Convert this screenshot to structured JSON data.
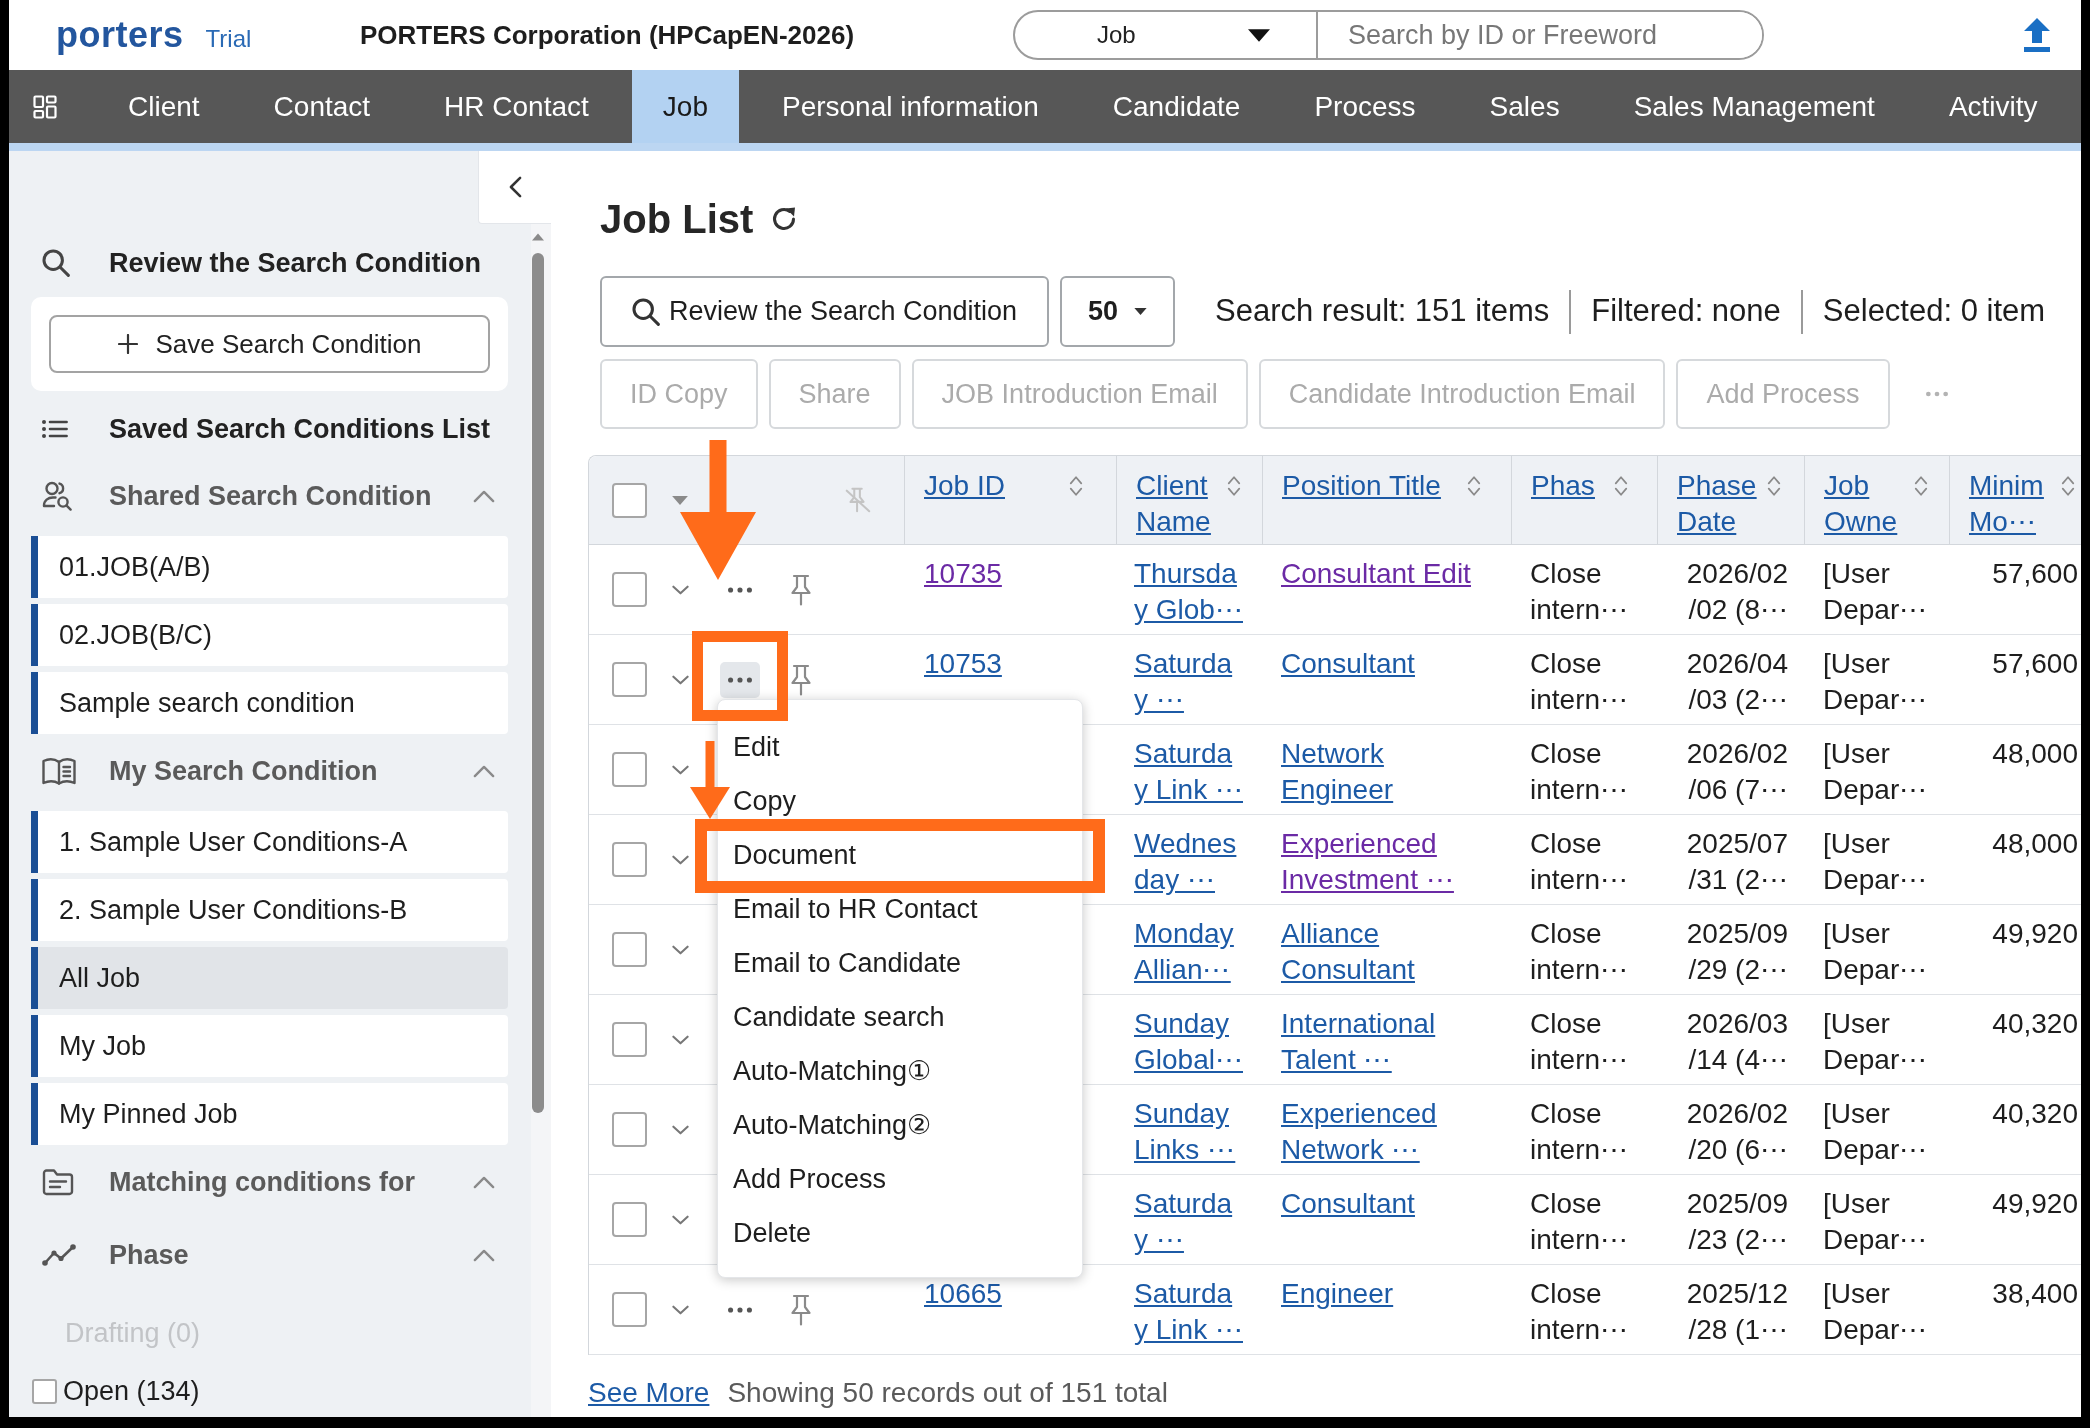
{
  "header": {
    "logo": "porters",
    "edition": "Trial",
    "company": "PORTERS Corporation (HPCapEN-2026)",
    "search": {
      "scope": "Job",
      "placeholder": "Search by ID or Freeword"
    }
  },
  "nav": {
    "items": [
      {
        "label": "Client",
        "selected": false
      },
      {
        "label": "Contact",
        "selected": false
      },
      {
        "label": "HR Contact",
        "selected": false
      },
      {
        "label": "Job",
        "selected": true
      },
      {
        "label": "Personal information",
        "selected": false
      },
      {
        "label": "Candidate",
        "selected": false
      },
      {
        "label": "Process",
        "selected": false
      },
      {
        "label": "Sales",
        "selected": false
      },
      {
        "label": "Sales Management",
        "selected": false
      },
      {
        "label": "Activity",
        "selected": false
      }
    ]
  },
  "sidebar": {
    "review_link": "Review the Search Condition",
    "save_button": "Save Search Condition",
    "saved_list_link": "Saved Search Conditions List",
    "sections": [
      {
        "title": "Shared Search Condition",
        "expanded": true,
        "items": [
          {
            "label": "01.JOB(A/B)",
            "selected": false
          },
          {
            "label": "02.JOB(B/C)",
            "selected": false
          },
          {
            "label": "Sample search condition",
            "selected": false
          }
        ]
      },
      {
        "title": "My Search Condition",
        "expanded": true,
        "items": [
          {
            "label": "1. Sample User Conditions-A",
            "selected": false
          },
          {
            "label": "2. Sample User Conditions-B",
            "selected": false
          },
          {
            "label": "All Job",
            "selected": true
          },
          {
            "label": "My Job",
            "selected": false
          },
          {
            "label": "My Pinned Job",
            "selected": false
          }
        ]
      },
      {
        "title": "Matching conditions for",
        "expanded": true
      },
      {
        "title": "Phase",
        "expanded": true,
        "filters": [
          {
            "label": "Drafting (0)",
            "disabled": true
          },
          {
            "label": "Open (134)",
            "disabled": false,
            "checked": false
          }
        ]
      }
    ]
  },
  "main": {
    "title": "Job List",
    "toolbar": {
      "review_button": "Review the Search Condition",
      "page_size": "50",
      "result": "Search result: 151 items",
      "filtered": "Filtered: none",
      "selected": "Selected: 0 item"
    },
    "actions": [
      {
        "label": "ID Copy",
        "disabled": true
      },
      {
        "label": "Share",
        "disabled": true
      },
      {
        "label": "JOB Introduction Email",
        "disabled": true
      },
      {
        "label": "Candidate Introduction Email",
        "disabled": true
      },
      {
        "label": "Add Process",
        "disabled": true
      }
    ],
    "table": {
      "select_all": {
        "checked": false
      },
      "columns": [
        {
          "lines": [
            "Job ID"
          ]
        },
        {
          "lines": [
            "Client",
            "Name"
          ]
        },
        {
          "lines": [
            "Position Title"
          ]
        },
        {
          "lines": [
            "Phas"
          ]
        },
        {
          "lines": [
            "Phase",
            "Date"
          ]
        },
        {
          "lines": [
            "Job",
            "Owne"
          ]
        },
        {
          "lines": [
            "Minim",
            "Mo⋯"
          ]
        }
      ],
      "rows": [
        {
          "checked": false,
          "more": {
            "active": false,
            "callout": false
          },
          "job_id": {
            "text": "10735",
            "visited": true
          },
          "client_name": [
            "Thursda",
            "y Glob⋯"
          ],
          "position_title": {
            "lines": [
              "Consultant Edit"
            ],
            "visited": true
          },
          "phase": [
            "Close",
            "intern⋯"
          ],
          "phase_date": [
            "2026/02",
            "/02 (8⋯"
          ],
          "job_owner": [
            "[User",
            "Depar⋯"
          ],
          "minimum": "57,600"
        },
        {
          "checked": false,
          "more": {
            "active": true,
            "callout": true
          },
          "job_id": {
            "text": "10753",
            "visited": false
          },
          "client_name": [
            "Saturda",
            "y ⋯"
          ],
          "position_title": {
            "lines": [
              "Consultant"
            ],
            "visited": false
          },
          "phase": [
            "Close",
            "intern⋯"
          ],
          "phase_date": [
            "2026/04",
            "/03 (2⋯"
          ],
          "job_owner": [
            "[User",
            "Depar⋯"
          ],
          "minimum": "57,600"
        },
        {
          "checked": false,
          "client_name": [
            "Saturda",
            "y Link ⋯"
          ],
          "position_title": {
            "lines": [
              "Network",
              "Engineer"
            ],
            "visited": false
          },
          "phase": [
            "Close",
            "intern⋯"
          ],
          "phase_date": [
            "2026/02",
            "/06 (7⋯"
          ],
          "job_owner": [
            "[User",
            "Depar⋯"
          ],
          "minimum": "48,000"
        },
        {
          "checked": false,
          "client_name": [
            "Wednes",
            "day ⋯"
          ],
          "position_title": {
            "lines": [
              "Experienced",
              "Investment ⋯"
            ],
            "visited": true
          },
          "phase": [
            "Close",
            "intern⋯"
          ],
          "phase_date": [
            "2025/07",
            "/31 (2⋯"
          ],
          "job_owner": [
            "[User",
            "Depar⋯"
          ],
          "minimum": "48,000"
        },
        {
          "checked": false,
          "client_name": [
            "Monday",
            "Allian⋯"
          ],
          "position_title": {
            "lines": [
              "Alliance",
              "Consultant"
            ],
            "visited": false
          },
          "phase": [
            "Close",
            "intern⋯"
          ],
          "phase_date": [
            "2025/09",
            "/29 (2⋯"
          ],
          "job_owner": [
            "[User",
            "Depar⋯"
          ],
          "minimum": "49,920"
        },
        {
          "checked": false,
          "client_name": [
            "Sunday",
            "Global⋯"
          ],
          "position_title": {
            "lines": [
              "International",
              "Talent ⋯"
            ],
            "visited": false
          },
          "phase": [
            "Close",
            "intern⋯"
          ],
          "phase_date": [
            "2026/03",
            "/14 (4⋯"
          ],
          "job_owner": [
            "[User",
            "Depar⋯"
          ],
          "minimum": "40,320"
        },
        {
          "checked": false,
          "client_name": [
            "Sunday",
            "Links ⋯"
          ],
          "position_title": {
            "lines": [
              "Experienced",
              "Network ⋯"
            ],
            "visited": false
          },
          "phase": [
            "Close",
            "intern⋯"
          ],
          "phase_date": [
            "2026/02",
            "/20 (6⋯"
          ],
          "job_owner": [
            "[User",
            "Depar⋯"
          ],
          "minimum": "40,320"
        },
        {
          "checked": false,
          "client_name": [
            "Saturda",
            "y ⋯"
          ],
          "position_title": {
            "lines": [
              "Consultant"
            ],
            "visited": false
          },
          "phase": [
            "Close",
            "intern⋯"
          ],
          "phase_date": [
            "2025/09",
            "/23 (2⋯"
          ],
          "job_owner": [
            "[User",
            "Depar⋯"
          ],
          "minimum": "49,920"
        },
        {
          "checked": false,
          "more": {
            "active": false,
            "callout": false
          },
          "job_id": {
            "text": "10665",
            "visited": false
          },
          "client_name": [
            "Saturda",
            "y Link ⋯"
          ],
          "position_title": {
            "lines": [
              "Engineer"
            ],
            "visited": false
          },
          "phase": [
            "Close",
            "intern⋯"
          ],
          "phase_date": [
            "2025/12",
            "/28 (1⋯"
          ],
          "job_owner": [
            "[User",
            "Depar⋯"
          ],
          "minimum": "38,400"
        }
      ],
      "row_menu": {
        "items": [
          {
            "label": "Edit",
            "callout": false
          },
          {
            "label": "Copy",
            "callout": false
          },
          {
            "label": "Document",
            "callout": true
          },
          {
            "label": "Email to HR Contact",
            "callout": false
          },
          {
            "label": "Email to Candidate",
            "callout": false
          },
          {
            "label": "Candidate search",
            "callout": false
          },
          {
            "label": "Auto-Matching①",
            "callout": false
          },
          {
            "label": "Auto-Matching②",
            "callout": false
          },
          {
            "label": "Add Process",
            "callout": false
          },
          {
            "label": "Delete",
            "callout": false
          }
        ]
      }
    },
    "footer": {
      "see_more": "See More",
      "summary": "Showing 50 records out of 151 total"
    }
  }
}
